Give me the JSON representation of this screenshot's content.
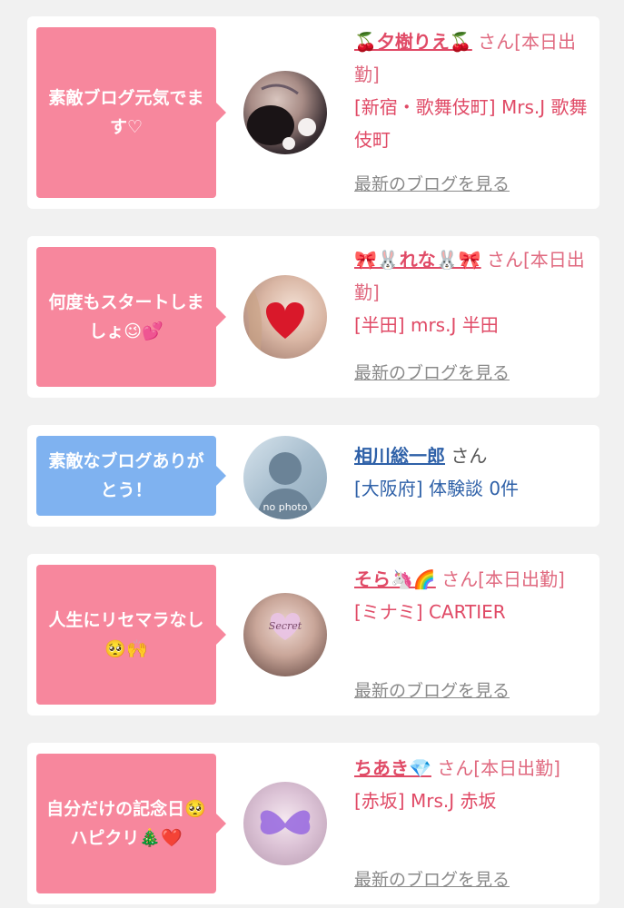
{
  "cards": [
    {
      "bubble": "素敵ブログ元気でます♡",
      "name": "🍒夕樹りえ🍒",
      "suffix": "さん[本日出勤]",
      "shop": "[新宿・歌舞伎町] Mrs.J 歌舞伎町",
      "link": "最新のブログを見る"
    },
    {
      "bubble": "何度もスタートしましょ😉💕",
      "name": "🎀🐰れな🐰🎀",
      "suffix": "さん[本日出勤]",
      "shop": "[半田] mrs.J 半田",
      "link": "最新のブログを見る"
    },
    {
      "bubble": "素敵なブログありがとう！",
      "name": "相川総一郎",
      "suffix": "さん",
      "shop": "[大阪府] 体験談 0件",
      "avatar_text": "no photo"
    },
    {
      "bubble": "人生にリセマラなし🥺🙌",
      "name": "そら🦄🌈",
      "suffix": "さん[本日出勤]",
      "shop": "[ミナミ] CARTIER",
      "link": "最新のブログを見る",
      "avatar_text": "Secret"
    },
    {
      "bubble": "自分だけの記念日🥺ハピクリ🎄❤️",
      "name": "ちあき💎",
      "suffix": "さん[本日出勤]",
      "shop": "[赤坂] Mrs.J 赤坂",
      "link": "最新のブログを見る"
    }
  ],
  "colors": {
    "pink_bubble": "#f7879d",
    "blue_bubble": "#7fb2f0",
    "pink_text": "#e04a66",
    "blue_text": "#2f61a8"
  }
}
